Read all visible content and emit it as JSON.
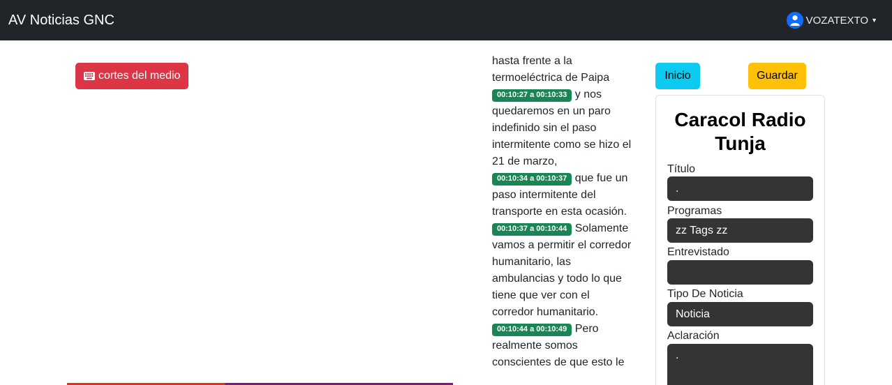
{
  "navbar": {
    "brand": "AV Noticias GNC",
    "user_name": "VOZATEXTO",
    "user_icon": "user-circle-icon",
    "caret_icon": "caret-down-icon"
  },
  "left": {
    "cortes_label": "cortes del medio",
    "cortes_icon": "keyboard-icon"
  },
  "transcript": {
    "segments": [
      {
        "text": "hasta frente a la termoeléctrica de Paipa"
      },
      {
        "ts": "00:10:27 a 00:10:33",
        "text": "y nos quedaremos en un paro indefinido sin el paso intermitente como se hizo el 21 de marzo,"
      },
      {
        "ts": "00:10:34 a 00:10:37",
        "text": "que fue un paso intermitente del transporte en esta ocasión."
      },
      {
        "ts": "00:10:37 a 00:10:44",
        "text": "Solamente vamos a permitir el corredor humanitario, las ambulancias y todo lo que tiene que ver con el corredor humanitario."
      },
      {
        "ts": "00:10:44 a 00:10:49",
        "text": "Pero realmente somos conscientes de que esto le"
      }
    ]
  },
  "actions": {
    "inicio": "Inicio",
    "guardar": "Guardar"
  },
  "form": {
    "title": "Caracol Radio Tunja",
    "titulo_label": "Título",
    "titulo_value": ".",
    "programas_label": "Programas",
    "programas_value": "zz Tags zz",
    "entrevistado_label": "Entrevistado",
    "entrevistado_value": "",
    "tipo_label": "Tipo De Noticia",
    "tipo_value": "Noticia",
    "aclaracion_label": "Aclaración",
    "aclaracion_value": "."
  },
  "colors": {
    "navbar": "#212529",
    "danger": "#dc3545",
    "info": "#0dcaf0",
    "warning": "#ffc107",
    "timestamp": "#198754",
    "field_bg": "#343434"
  }
}
